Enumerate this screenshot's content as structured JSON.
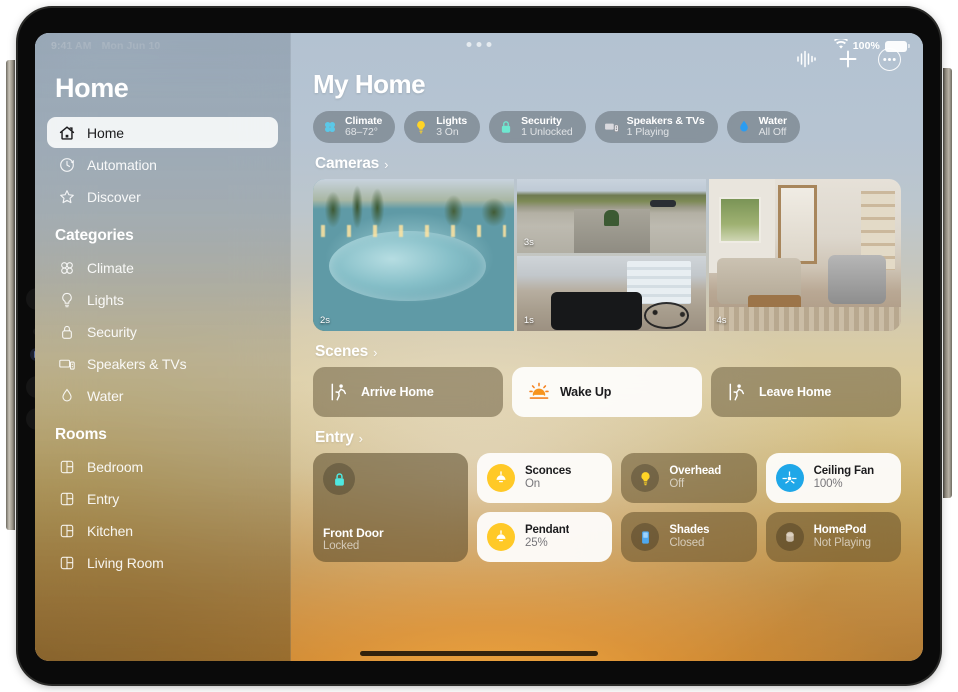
{
  "statusbar": {
    "time": "9:41 AM",
    "date": "Mon Jun 10",
    "wifi_icon": "wifi-icon",
    "battery_percent": "100%",
    "battery_icon": "battery-full-icon",
    "multitask_icon": "multitasking-dots-icon"
  },
  "sidebar": {
    "title": "Home",
    "primary_items": [
      {
        "label": "Home",
        "icon": "house-icon",
        "selected": true
      },
      {
        "label": "Automation",
        "icon": "clock-arrow-icon",
        "selected": false
      },
      {
        "label": "Discover",
        "icon": "star-icon",
        "selected": false
      }
    ],
    "categories_title": "Categories",
    "categories": [
      {
        "label": "Climate",
        "icon": "fan-icon"
      },
      {
        "label": "Lights",
        "icon": "lightbulb-icon"
      },
      {
        "label": "Security",
        "icon": "lock-icon"
      },
      {
        "label": "Speakers & TVs",
        "icon": "tv-remote-icon"
      },
      {
        "label": "Water",
        "icon": "water-drop-icon"
      }
    ],
    "rooms_title": "Rooms",
    "rooms": [
      {
        "label": "Bedroom",
        "icon": "room-icon"
      },
      {
        "label": "Entry",
        "icon": "room-icon"
      },
      {
        "label": "Kitchen",
        "icon": "room-icon"
      },
      {
        "label": "Living Room",
        "icon": "room-icon"
      }
    ]
  },
  "header": {
    "title": "My Home",
    "actions": [
      {
        "name": "audio-waveform-icon",
        "label": "Audio"
      },
      {
        "name": "plus-icon",
        "label": "Add"
      },
      {
        "name": "more-ellipsis-icon",
        "label": "More"
      }
    ]
  },
  "status_pills": [
    {
      "name": "Climate",
      "value": "68–72°",
      "icon": "fan-icon",
      "color": "#5BC8E8"
    },
    {
      "name": "Lights",
      "value": "3 On",
      "icon": "lightbulb-icon",
      "color": "#FFD426"
    },
    {
      "name": "Security",
      "value": "1 Unlocked",
      "icon": "lock-icon",
      "color": "#6FE8D0"
    },
    {
      "name": "Speakers & TVs",
      "value": "1 Playing",
      "icon": "tv-remote-icon",
      "color": "#D4D4D8"
    },
    {
      "name": "Water",
      "value": "All Off",
      "icon": "water-drop-icon",
      "color": "#2B9CF0"
    }
  ],
  "cameras": {
    "section_title": "Cameras",
    "chevron": "›",
    "feeds": [
      {
        "name": "pool-camera",
        "timestamp": "2s"
      },
      {
        "name": "driveway-camera",
        "timestamp": "3s"
      },
      {
        "name": "garage-camera",
        "timestamp": "1s"
      },
      {
        "name": "livingroom-camera",
        "timestamp": "4s"
      }
    ]
  },
  "scenes": {
    "section_title": "Scenes",
    "chevron": "›",
    "items": [
      {
        "label": "Arrive Home",
        "icon": "person-walk-in-icon",
        "active": false
      },
      {
        "label": "Wake Up",
        "icon": "sunrise-icon",
        "active": true
      },
      {
        "label": "Leave Home",
        "icon": "person-walk-out-icon",
        "active": false
      }
    ]
  },
  "entry": {
    "section_title": "Entry",
    "chevron": "›",
    "door": {
      "name": "Front Door",
      "status": "Locked",
      "icon": "lock-icon",
      "color": "#4FE8E0"
    },
    "tiles": [
      {
        "name": "Sconces",
        "status": "On",
        "icon": "pendant-lamp-icon",
        "color": "#FFC927",
        "light": true
      },
      {
        "name": "Pendant",
        "status": "25%",
        "icon": "pendant-lamp-icon",
        "color": "#FFC927",
        "light": true
      },
      {
        "name": "Overhead",
        "status": "Off",
        "icon": "lightbulb-icon",
        "color": "#FFD426",
        "light": false
      },
      {
        "name": "Shades",
        "status": "Closed",
        "icon": "shade-icon",
        "color": "#4EA8F0",
        "light": false
      },
      {
        "name": "Ceiling Fan",
        "status": "100%",
        "icon": "fan-icon",
        "color": "#1FA7E8",
        "light": true
      },
      {
        "name": "HomePod",
        "status": "Not Playing",
        "icon": "homepod-icon",
        "color": "#C9BBA8",
        "light": false
      }
    ]
  },
  "theme": {
    "accent_blue": "#1FA7E8",
    "accent_amber": "#FFC927",
    "accent_teal": "#4FE8E0",
    "sky_top": "#b3c2d1",
    "warm_bottom": "#a8722f"
  }
}
